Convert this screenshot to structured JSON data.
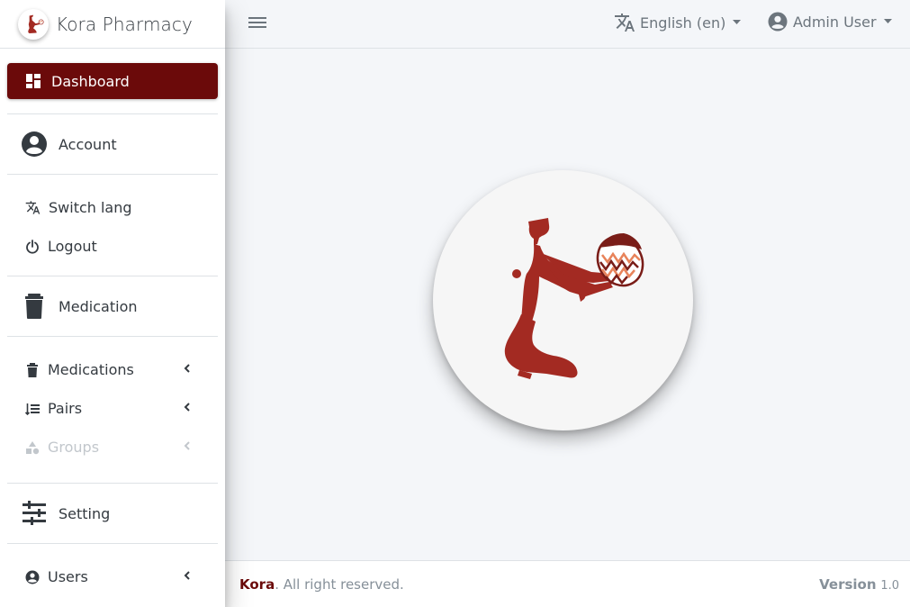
{
  "brand": {
    "name": "Kora Pharmacy"
  },
  "sidebar": {
    "dashboard": "Dashboard",
    "account_header": "Account",
    "switch_lang": "Switch lang",
    "logout": "Logout",
    "medication_header": "Medication",
    "medications": "Medications",
    "pairs": "Pairs",
    "groups": "Groups",
    "setting_header": "Setting",
    "users": "Users"
  },
  "header": {
    "language": "English (en)",
    "user": "Admin User"
  },
  "footer": {
    "brand": "Kora",
    "rights": ". All right reserved.",
    "version_label": "Version",
    "version_number": "1.0"
  },
  "colors": {
    "accent": "#6b0a0a",
    "logo_red": "#a32a22",
    "pot_stripe": "#e8835a"
  }
}
